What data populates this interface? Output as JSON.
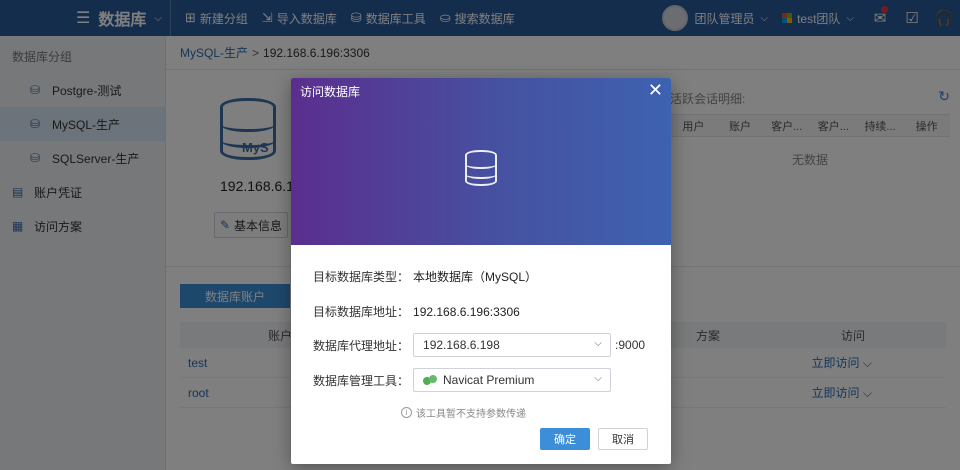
{
  "topbar": {
    "title": "数据库",
    "tools": [
      "新建分组",
      "导入数据库",
      "数据库工具",
      "搜索数据库"
    ],
    "user": "团队管理员",
    "team": "test团队",
    "colors": {
      "bar": "#2b5b9b"
    }
  },
  "sidebar": {
    "group_label": "数据库分组",
    "items": [
      "Postgre-测试",
      "MySQL-生产",
      "SQLServer-生产"
    ],
    "credentials": "账户凭证",
    "access_plan": "访问方案"
  },
  "main": {
    "breadcrumb_group": "MySQL-生产",
    "breadcrumb_sep": ">",
    "breadcrumb_current": "192.168.6.196:3306",
    "db_logo_text": "MyS",
    "host_text": "192.168.6.1",
    "basic_info_btn": "基本信息",
    "sessions_label": "活跃会话明细:",
    "session_columns": [
      "用户",
      "账户",
      "客户...",
      "客户...",
      "持续...",
      "操作"
    ],
    "no_data": "无数据",
    "accounts_tab": "数据库账户",
    "account_columns": [
      "账户",
      "方案",
      "访问"
    ],
    "accounts": [
      {
        "name": "test",
        "action": "立即访问"
      },
      {
        "name": "root",
        "action": "立即访问"
      }
    ]
  },
  "modal": {
    "title": "访问数据库",
    "close": "✕",
    "target_type_label": "目标数据库类型：",
    "target_type_value": "本地数据库（MySQL）",
    "target_addr_label": "目标数据库地址：",
    "target_addr_value": "192.168.6.196:3306",
    "proxy_label": "数据库代理地址：",
    "proxy_value": "192.168.6.198",
    "proxy_port": ":9000",
    "tool_label": "数据库管理工具：",
    "tool_value": "Navicat Premium",
    "hint": "该工具暂不支持参数传递",
    "ok": "确定",
    "cancel": "取消",
    "colors": {
      "gradient_start": "#5b2e8e",
      "gradient_end": "#3d62b0",
      "primary": "#3d8ed9"
    }
  }
}
